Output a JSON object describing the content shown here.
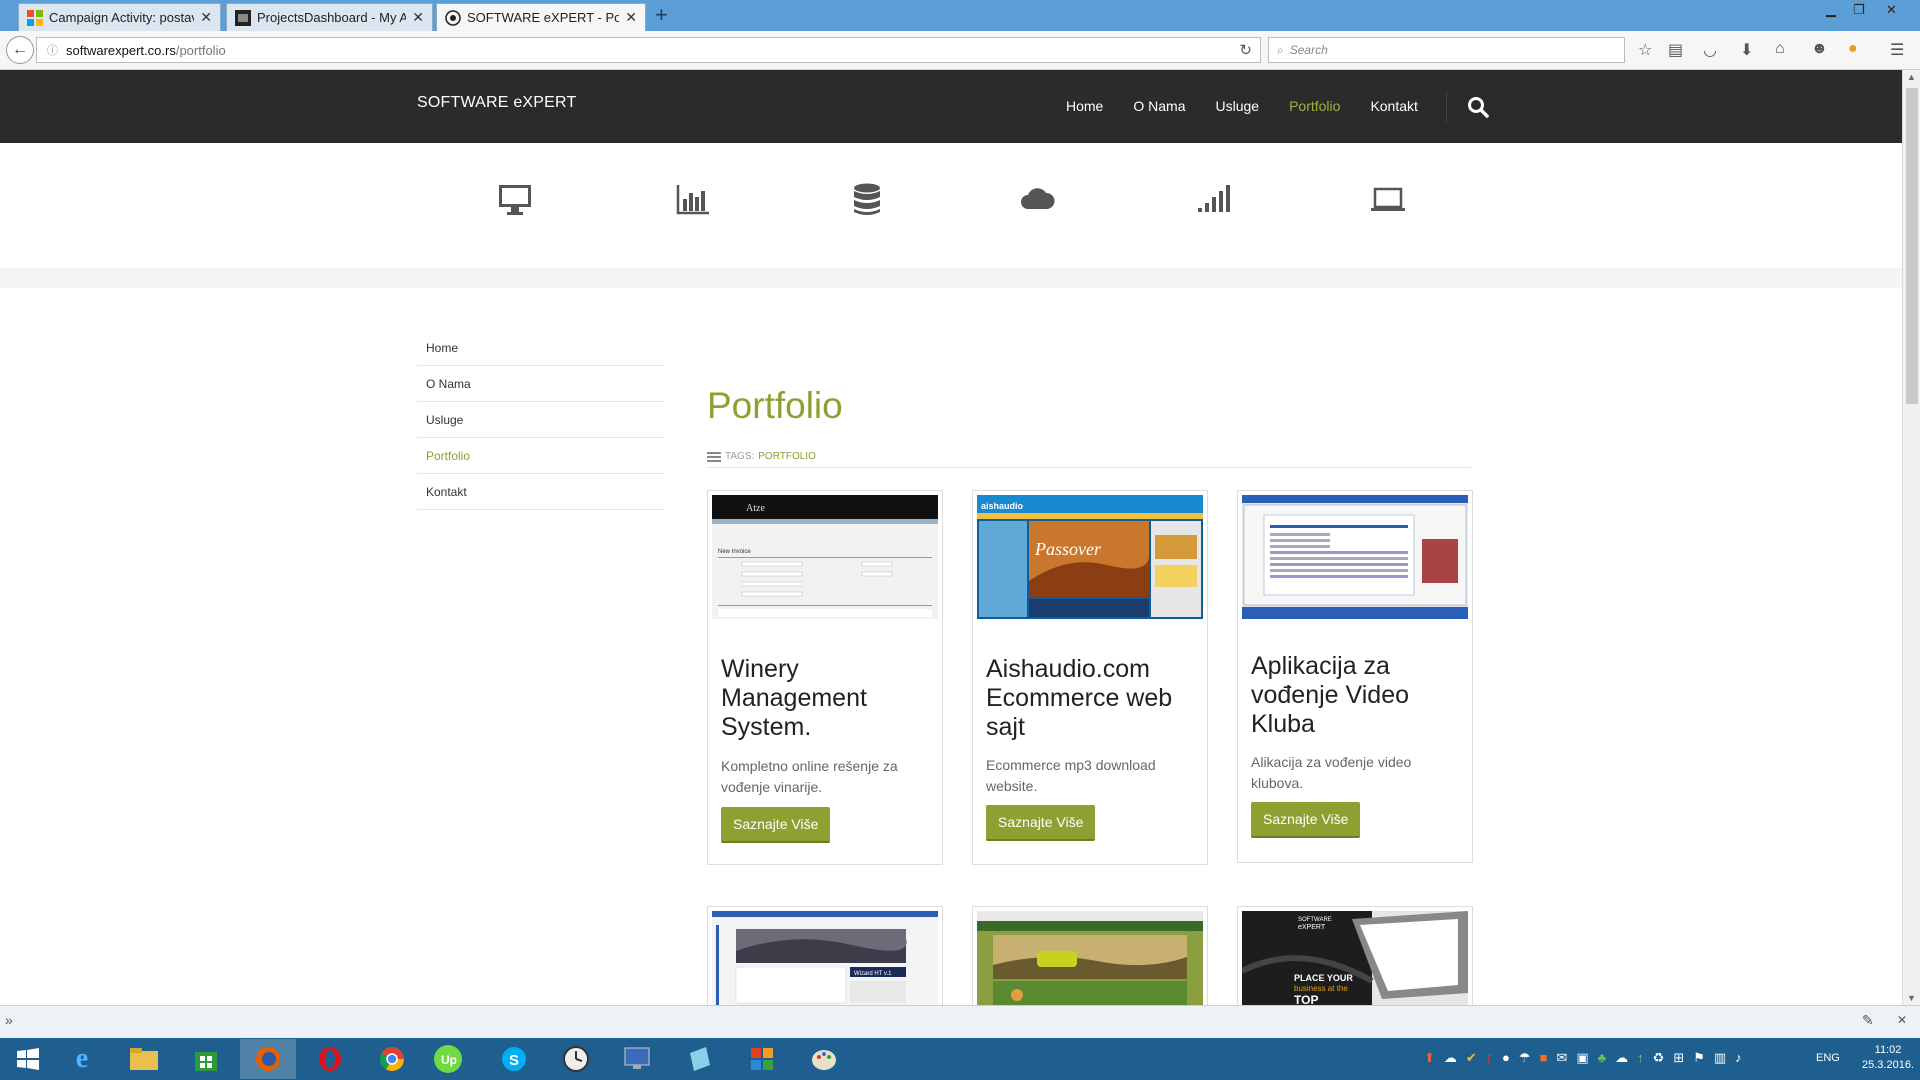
{
  "browser": {
    "tabs": [
      {
        "title": "Campaign Activity: postav...",
        "active": false
      },
      {
        "title": "ProjectsDashboard - My A...",
        "active": false
      },
      {
        "title": "SOFTWARE eXPERT - Port...",
        "active": true
      }
    ],
    "new_tab_label": "+",
    "url_host": "softwarexpert.co.rs",
    "url_path": "/portfolio",
    "search_placeholder": "Search"
  },
  "site": {
    "logo": "SOFTWARE eXPERT",
    "nav": [
      {
        "label": "Home",
        "active": false
      },
      {
        "label": "O Nama",
        "active": false
      },
      {
        "label": "Usluge",
        "active": false
      },
      {
        "label": "Portfolio",
        "active": true
      },
      {
        "label": "Kontakt",
        "active": false
      }
    ],
    "band_icons": [
      "desktop-icon",
      "bar-chart-icon",
      "database-icon",
      "cloud-icon",
      "signal-icon",
      "laptop-icon"
    ],
    "accent_color": "#8f9f32"
  },
  "sidebar": {
    "items": [
      {
        "label": "Home",
        "active": false
      },
      {
        "label": "O Nama",
        "active": false
      },
      {
        "label": "Usluge",
        "active": false
      },
      {
        "label": "Portfolio",
        "active": true
      },
      {
        "label": "Kontakt",
        "active": false
      }
    ]
  },
  "page": {
    "title": "Portfolio",
    "tags_label": "TAGS:",
    "tag": "PORTFOLIO"
  },
  "cards": [
    {
      "title": "Winery Management System.",
      "description": "Kompletno online rešenje za vođenje vinarije.",
      "button": "Saznajte Više"
    },
    {
      "title": "Aishaudio.com Ecommerce web sajt",
      "description": "Ecommerce mp3 download website.",
      "button": "Saznajte Više"
    },
    {
      "title": "Aplikacija za vođenje Video Kluba",
      "description": "Alikacija za vođenje video klubova.",
      "button": "Saznajte Više"
    }
  ],
  "thumb_texts": {
    "atze": "Atze",
    "new_invoice": "New Invoice",
    "aishaudio": "aishaudio",
    "passover": "Passover",
    "wizard": "Wizard HT v.1",
    "software": "SOFTWARE",
    "expert": "eXPERT",
    "place_your": "PLACE YOUR",
    "business_at_the": "business at the",
    "top": "TOP"
  },
  "taskbar": {
    "language": "ENG",
    "time": "11:02",
    "date": "25.3.2016."
  }
}
